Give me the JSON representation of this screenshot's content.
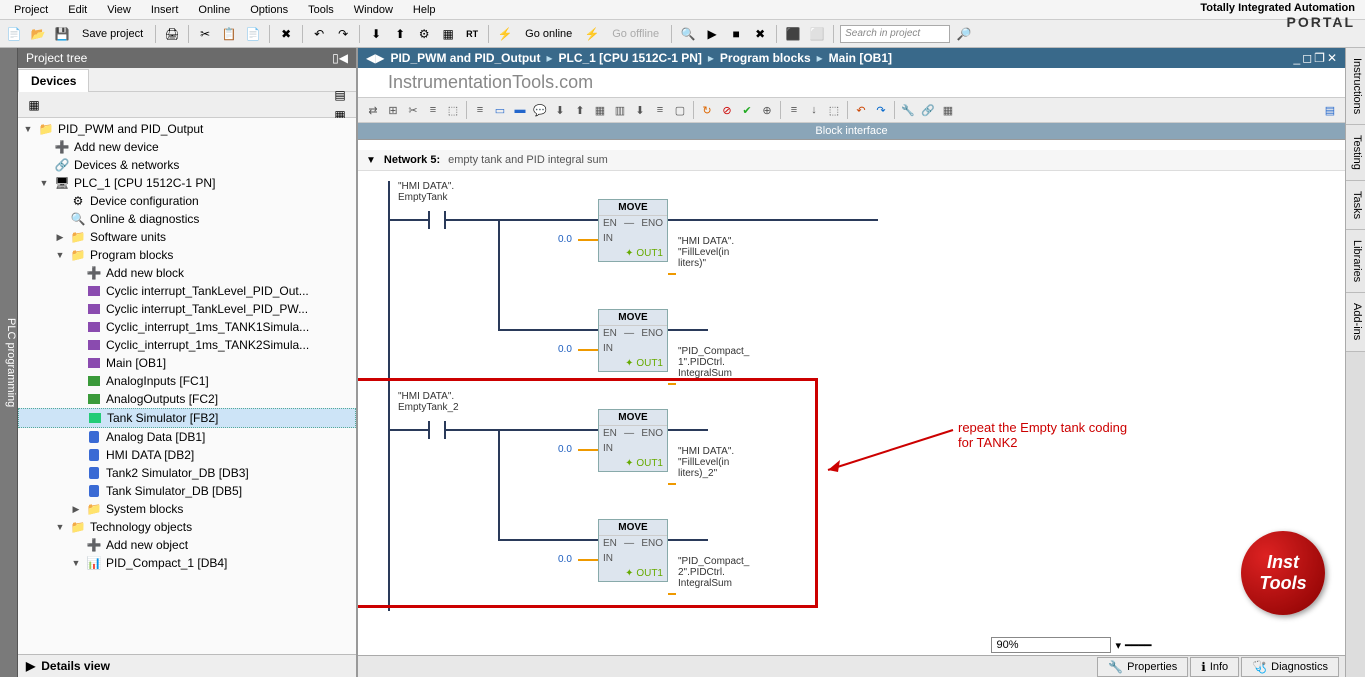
{
  "brand": {
    "line1": "Totally Integrated Automation",
    "line2": "PORTAL"
  },
  "menu": [
    "Project",
    "Edit",
    "View",
    "Insert",
    "Online",
    "Options",
    "Tools",
    "Window",
    "Help"
  ],
  "toolbar": {
    "save": "Save project",
    "go_online": "Go online",
    "go_offline": "Go offline",
    "search_ph": "Search in project"
  },
  "project_tree": {
    "title": "Project tree",
    "tab": "Devices",
    "details": "Details view"
  },
  "tree": [
    {
      "ind": 0,
      "arrow": "▼",
      "icon": "proj",
      "label": "PID_PWM and PID_Output"
    },
    {
      "ind": 1,
      "arrow": "",
      "icon": "add",
      "label": "Add new device"
    },
    {
      "ind": 1,
      "arrow": "",
      "icon": "net",
      "label": "Devices & networks"
    },
    {
      "ind": 1,
      "arrow": "▼",
      "icon": "plc",
      "label": "PLC_1 [CPU 1512C-1 PN]"
    },
    {
      "ind": 2,
      "arrow": "",
      "icon": "cfg",
      "label": "Device configuration"
    },
    {
      "ind": 2,
      "arrow": "",
      "icon": "diag",
      "label": "Online & diagnostics"
    },
    {
      "ind": 2,
      "arrow": "▶",
      "icon": "folder",
      "label": "Software units"
    },
    {
      "ind": 2,
      "arrow": "▼",
      "icon": "folder",
      "label": "Program blocks"
    },
    {
      "ind": 3,
      "arrow": "",
      "icon": "add",
      "label": "Add new block"
    },
    {
      "ind": 3,
      "arrow": "",
      "icon": "ob",
      "label": "Cyclic interrupt_TankLevel_PID_Out..."
    },
    {
      "ind": 3,
      "arrow": "",
      "icon": "ob",
      "label": "Cyclic interrupt_TankLevel_PID_PW..."
    },
    {
      "ind": 3,
      "arrow": "",
      "icon": "ob",
      "label": "Cyclic_interrupt_1ms_TANK1Simula..."
    },
    {
      "ind": 3,
      "arrow": "",
      "icon": "ob",
      "label": "Cyclic_interrupt_1ms_TANK2Simula..."
    },
    {
      "ind": 3,
      "arrow": "",
      "icon": "ob",
      "label": "Main [OB1]"
    },
    {
      "ind": 3,
      "arrow": "",
      "icon": "fc",
      "label": "AnalogInputs [FC1]"
    },
    {
      "ind": 3,
      "arrow": "",
      "icon": "fc",
      "label": "AnalogOutputs [FC2]"
    },
    {
      "ind": 3,
      "arrow": "",
      "icon": "fb",
      "label": "Tank Simulator [FB2]",
      "sel": true
    },
    {
      "ind": 3,
      "arrow": "",
      "icon": "db",
      "label": "Analog Data [DB1]"
    },
    {
      "ind": 3,
      "arrow": "",
      "icon": "db",
      "label": "HMI DATA [DB2]"
    },
    {
      "ind": 3,
      "arrow": "",
      "icon": "db",
      "label": "Tank2 Simulator_DB [DB3]"
    },
    {
      "ind": 3,
      "arrow": "",
      "icon": "db",
      "label": "Tank Simulator_DB [DB5]"
    },
    {
      "ind": 3,
      "arrow": "▶",
      "icon": "folder",
      "label": "System blocks"
    },
    {
      "ind": 2,
      "arrow": "▼",
      "icon": "folder",
      "label": "Technology objects"
    },
    {
      "ind": 3,
      "arrow": "",
      "icon": "add",
      "label": "Add new object"
    },
    {
      "ind": 3,
      "arrow": "▼",
      "icon": "to",
      "label": "PID_Compact_1 [DB4]"
    }
  ],
  "breadcrumb": [
    "PID_PWM and PID_Output",
    "PLC_1 [CPU 1512C-1 PN]",
    "Program blocks",
    "Main [OB1]"
  ],
  "watermark": "InstrumentationTools.com",
  "block_interface": "Block interface",
  "network": {
    "label": "Network 5:",
    "title": "empty tank and PID integral sum"
  },
  "ladder1": {
    "contact": "\"HMI DATA\".\nEmptyTank",
    "move1": {
      "title": "MOVE",
      "en": "EN",
      "eno": "ENO",
      "in": "IN",
      "in_val": "0.0",
      "out": "OUT1",
      "out_label": "\"HMI DATA\".\n\"FillLevel(in\nliters)\""
    },
    "move2": {
      "title": "MOVE",
      "en": "EN",
      "eno": "ENO",
      "in": "IN",
      "in_val": "0.0",
      "out": "OUT1",
      "out_label": "\"PID_Compact_\n1\".PIDCtrl.\nIntegralSum"
    }
  },
  "ladder2": {
    "contact": "\"HMI DATA\".\nEmptyTank_2",
    "move1": {
      "title": "MOVE",
      "en": "EN",
      "eno": "ENO",
      "in": "IN",
      "in_val": "0.0",
      "out": "OUT1",
      "out_label": "\"HMI DATA\".\n\"FillLevel(in\nliters)_2\""
    },
    "move2": {
      "title": "MOVE",
      "en": "EN",
      "eno": "ENO",
      "in": "IN",
      "in_val": "0.0",
      "out": "OUT1",
      "out_label": "\"PID_Compact_\n2\".PIDCtrl.\nIntegralSum"
    }
  },
  "annotation": "repeat the Empty tank coding\nfor TANK2",
  "zoom": "90%",
  "bottom_tabs": {
    "props": "Properties",
    "info": "Info",
    "diag": "Diagnostics"
  },
  "right_tabs": [
    "Instructions",
    "Testing",
    "Tasks",
    "Libraries",
    "Add-ins"
  ],
  "badge": {
    "l1": "Inst",
    "l2": "Tools"
  }
}
